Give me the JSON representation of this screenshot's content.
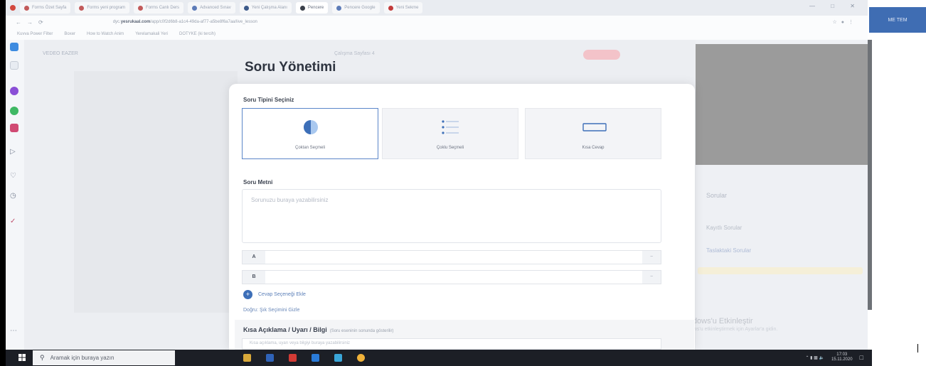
{
  "browser": {
    "tabs": [
      {
        "label": "Forms Özet Sayfa",
        "active": false
      },
      {
        "label": "Forms yeni program",
        "active": false
      },
      {
        "label": "Forms Canlı Ders",
        "active": false
      },
      {
        "label": "Advanced Sınav",
        "active": false
      },
      {
        "label": "Yeni Çalışma Alanı",
        "active": false
      },
      {
        "label": "Pencere",
        "active": true
      },
      {
        "label": "Pencere Google",
        "active": false
      },
      {
        "label": "Yeni Sekme",
        "active": false
      }
    ],
    "address_prefix": "dyc.",
    "address_domain": "yesrukaal.com",
    "address_rest": "/app/c0f2d6b8-a1c4-49da-af77-a5be8f6a7aa/live_lesson",
    "bookmarks": [
      "Kuvva Power Filter",
      "Boxer",
      "How to Watch Anim",
      "Yerelamakali Yeri",
      "DOTYKE (ki tercih)"
    ]
  },
  "top_right_badge": "ME TEM",
  "page": {
    "course_name": "VEDEO EAZER",
    "tab_label": "Çalışma Sayfası 4",
    "side_panel_title": "Sorular",
    "saved_questions": "Kayıtlı Sorular",
    "draft_questions": "Taslaktaki Sorular",
    "watermark_line1": "Windows'u Etkinleştir",
    "watermark_line2": "Windows'u etkinleştirmek için Ayarlar'a gidin."
  },
  "modal": {
    "title": "Soru Yönetimi",
    "type_section_label": "Soru Tipini Seçiniz",
    "types": [
      {
        "label": "Çoktan Seçmeli",
        "selected": true
      },
      {
        "label": "Çoklu Seçmeli",
        "selected": false
      },
      {
        "label": "Kısa Cevap",
        "selected": false
      }
    ],
    "text_section_label": "Soru Metni",
    "text_placeholder": "Sorunuzu buraya yazabilirsiniz",
    "options": [
      {
        "letter": "A",
        "value": ""
      },
      {
        "letter": "B",
        "value": ""
      }
    ],
    "add_option_label": "Cevap Seçeneği Ekle",
    "multi_link_label": "Doğru: Şık Seçimini Gizle",
    "info_title": "Kısa Açıklama / Uyarı / Bilgi",
    "info_hint": "(Soru eseninin sonunda gösterilir)",
    "info_placeholder": "Kısa açıklama, uyarı veya bilgiyi buraya yazabilirsiniz"
  },
  "taskbar": {
    "search_placeholder": "Aramak için buraya yazın",
    "time": "17:03",
    "date": "15.11.2020"
  },
  "colors": {
    "accent": "#3d6fb8",
    "selected_border": "#5b86c9",
    "taskbar": "#1c1f26"
  }
}
